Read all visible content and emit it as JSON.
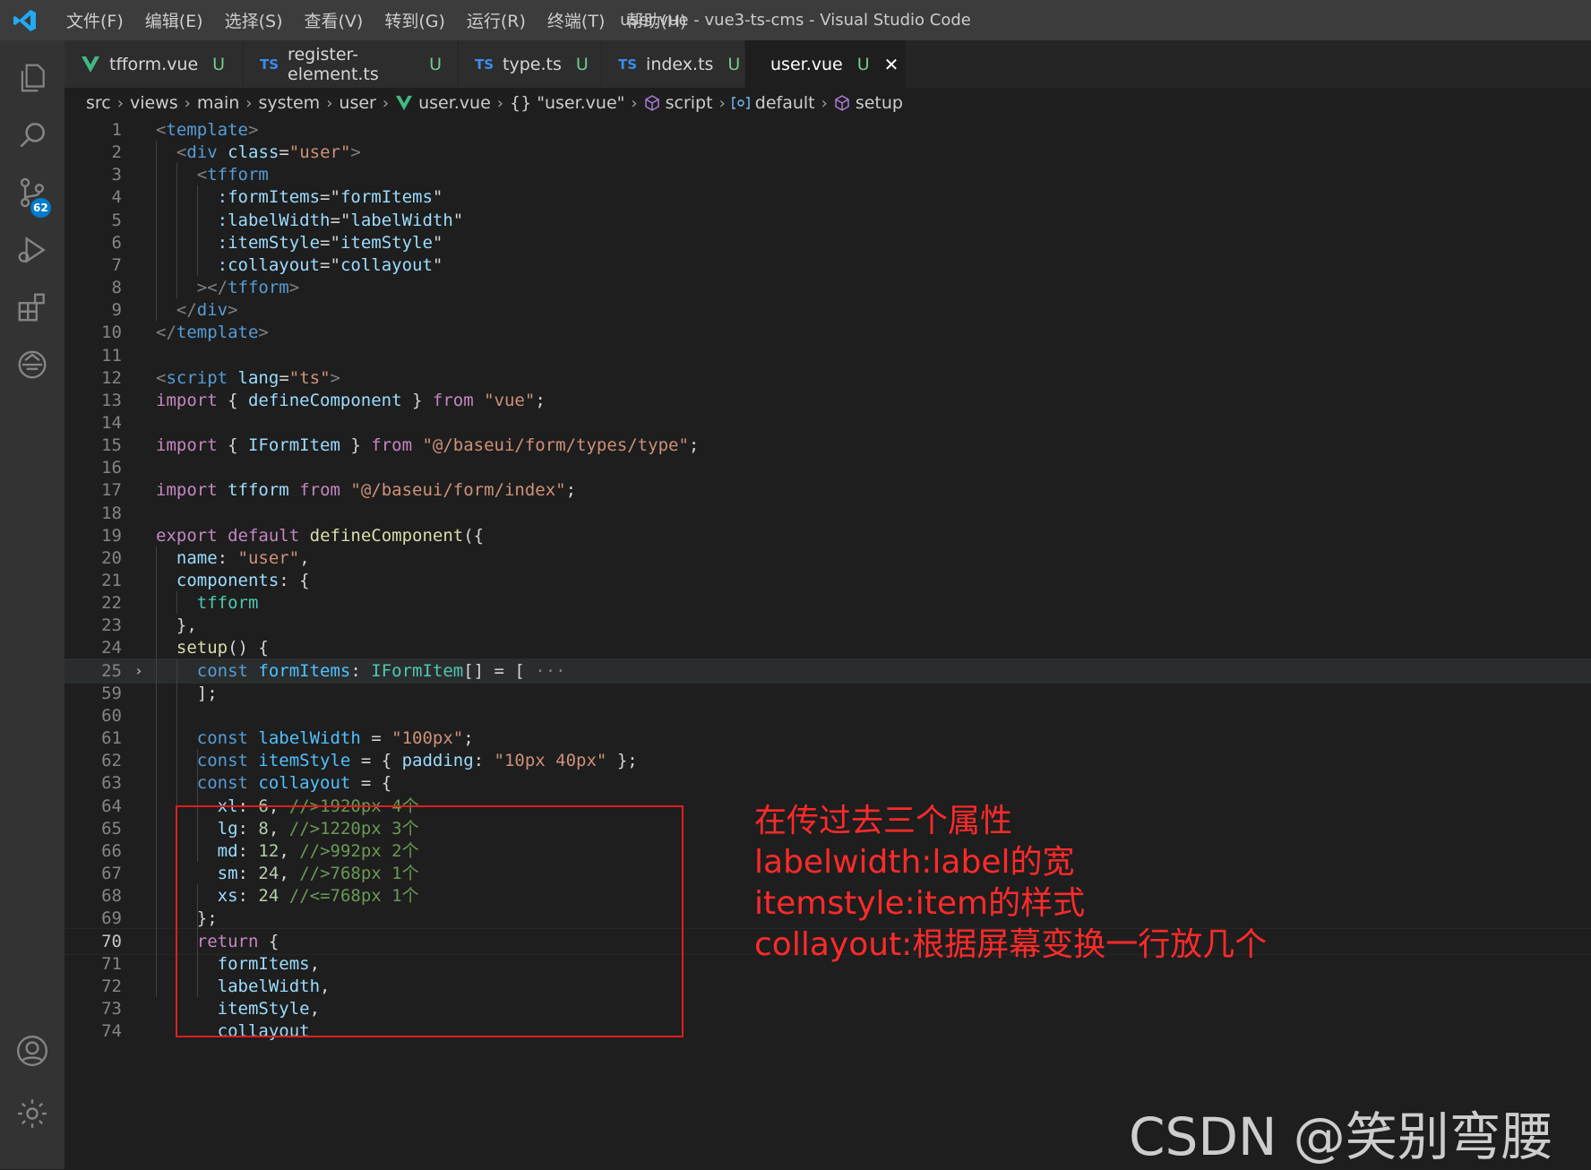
{
  "titlebar": {
    "menu": [
      "文件(F)",
      "编辑(E)",
      "选择(S)",
      "查看(V)",
      "转到(G)",
      "运行(R)",
      "终端(T)",
      "帮助(H)"
    ],
    "title": "user.vue - vue3-ts-cms - Visual Studio Code"
  },
  "activitybar": {
    "items": [
      "explorer-icon",
      "search-icon",
      "source-control-icon",
      "run-debug-icon",
      "extensions-icon",
      "remote-icon"
    ],
    "source_control_badge": "62",
    "bottom": [
      "account-icon",
      "settings-gear-icon"
    ]
  },
  "tabs": [
    {
      "icon": "V",
      "label": "tfform.vue",
      "status": "U"
    },
    {
      "icon": "TS",
      "label": "register-element.ts",
      "status": "U"
    },
    {
      "icon": "TS",
      "label": "type.ts",
      "status": "U"
    },
    {
      "icon": "TS",
      "label": "index.ts",
      "status": "U"
    },
    {
      "icon": "V",
      "label": "user.vue",
      "status": "U",
      "active": true
    }
  ],
  "breadcrumb": [
    "src",
    "views",
    "main",
    "system",
    "user",
    "user.vue",
    "{} \"user.vue\"",
    "script",
    "default",
    "setup"
  ],
  "code": [
    {
      "n": "1",
      "t": [
        [
          "t-pun",
          "<"
        ],
        [
          "t-tag",
          "template"
        ],
        [
          "t-pun",
          ">"
        ]
      ]
    },
    {
      "n": "2",
      "t": [
        [
          "t-plain",
          "  "
        ],
        [
          "t-pun",
          "<"
        ],
        [
          "t-tag",
          "div"
        ],
        [
          "t-plain",
          " "
        ],
        [
          "t-attr",
          "class"
        ],
        [
          "t-plain",
          "="
        ],
        [
          "t-str",
          "\"user\""
        ],
        [
          "t-pun",
          ">"
        ]
      ]
    },
    {
      "n": "3",
      "t": [
        [
          "t-plain",
          "    "
        ],
        [
          "t-pun",
          "<"
        ],
        [
          "t-tag",
          "tfform"
        ]
      ]
    },
    {
      "n": "4",
      "t": [
        [
          "t-plain",
          "      "
        ],
        [
          "t-attr",
          ":formItems"
        ],
        [
          "t-plain",
          "="
        ],
        [
          "t-plain",
          "\""
        ],
        [
          "t-var",
          "formItems"
        ],
        [
          "t-plain",
          "\""
        ]
      ]
    },
    {
      "n": "5",
      "t": [
        [
          "t-plain",
          "      "
        ],
        [
          "t-attr",
          ":labelWidth"
        ],
        [
          "t-plain",
          "="
        ],
        [
          "t-plain",
          "\""
        ],
        [
          "t-var",
          "labelWidth"
        ],
        [
          "t-plain",
          "\""
        ]
      ]
    },
    {
      "n": "6",
      "t": [
        [
          "t-plain",
          "      "
        ],
        [
          "t-attr",
          ":itemStyle"
        ],
        [
          "t-plain",
          "="
        ],
        [
          "t-plain",
          "\""
        ],
        [
          "t-var",
          "itemStyle"
        ],
        [
          "t-plain",
          "\""
        ]
      ]
    },
    {
      "n": "7",
      "t": [
        [
          "t-plain",
          "      "
        ],
        [
          "t-attr",
          ":collayout"
        ],
        [
          "t-plain",
          "="
        ],
        [
          "t-plain",
          "\""
        ],
        [
          "t-var",
          "collayout"
        ],
        [
          "t-plain",
          "\""
        ]
      ]
    },
    {
      "n": "8",
      "t": [
        [
          "t-plain",
          "    "
        ],
        [
          "t-pun",
          "></"
        ],
        [
          "t-tag",
          "tfform"
        ],
        [
          "t-pun",
          ">"
        ]
      ]
    },
    {
      "n": "9",
      "t": [
        [
          "t-plain",
          "  "
        ],
        [
          "t-pun",
          "</"
        ],
        [
          "t-tag",
          "div"
        ],
        [
          "t-pun",
          ">"
        ]
      ]
    },
    {
      "n": "10",
      "t": [
        [
          "t-pun",
          "</"
        ],
        [
          "t-tag",
          "template"
        ],
        [
          "t-pun",
          ">"
        ]
      ]
    },
    {
      "n": "11",
      "t": []
    },
    {
      "n": "12",
      "t": [
        [
          "t-pun",
          "<"
        ],
        [
          "t-tag",
          "script"
        ],
        [
          "t-plain",
          " "
        ],
        [
          "t-attr",
          "lang"
        ],
        [
          "t-plain",
          "="
        ],
        [
          "t-str",
          "\"ts\""
        ],
        [
          "t-pun",
          ">"
        ]
      ]
    },
    {
      "n": "13",
      "t": [
        [
          "t-kw",
          "import"
        ],
        [
          "t-plain",
          " { "
        ],
        [
          "t-var",
          "defineComponent"
        ],
        [
          "t-plain",
          " } "
        ],
        [
          "t-kw",
          "from"
        ],
        [
          "t-plain",
          " "
        ],
        [
          "t-str",
          "\"vue\""
        ],
        [
          "t-plain",
          ";"
        ]
      ]
    },
    {
      "n": "14",
      "t": []
    },
    {
      "n": "15",
      "t": [
        [
          "t-kw",
          "import"
        ],
        [
          "t-plain",
          " { "
        ],
        [
          "t-var",
          "IFormItem"
        ],
        [
          "t-plain",
          " } "
        ],
        [
          "t-kw",
          "from"
        ],
        [
          "t-plain",
          " "
        ],
        [
          "t-str",
          "\"@/baseui/form/types/type\""
        ],
        [
          "t-plain",
          ";"
        ]
      ]
    },
    {
      "n": "16",
      "t": []
    },
    {
      "n": "17",
      "t": [
        [
          "t-kw",
          "import"
        ],
        [
          "t-plain",
          " "
        ],
        [
          "t-var",
          "tfform"
        ],
        [
          "t-plain",
          " "
        ],
        [
          "t-kw",
          "from"
        ],
        [
          "t-plain",
          " "
        ],
        [
          "t-str",
          "\"@/baseui/form/index\""
        ],
        [
          "t-plain",
          ";"
        ]
      ]
    },
    {
      "n": "18",
      "t": []
    },
    {
      "n": "19",
      "t": [
        [
          "t-kw",
          "export"
        ],
        [
          "t-plain",
          " "
        ],
        [
          "t-kw",
          "default"
        ],
        [
          "t-plain",
          " "
        ],
        [
          "t-fn",
          "defineComponent"
        ],
        [
          "t-plain",
          "({"
        ]
      ]
    },
    {
      "n": "20",
      "t": [
        [
          "t-plain",
          "  "
        ],
        [
          "t-var",
          "name"
        ],
        [
          "t-plain",
          ": "
        ],
        [
          "t-str",
          "\"user\""
        ],
        [
          "t-plain",
          ","
        ]
      ]
    },
    {
      "n": "21",
      "t": [
        [
          "t-plain",
          "  "
        ],
        [
          "t-var",
          "components"
        ],
        [
          "t-plain",
          ": {"
        ]
      ]
    },
    {
      "n": "22",
      "t": [
        [
          "t-plain",
          "    "
        ],
        [
          "t-type",
          "tfform"
        ]
      ]
    },
    {
      "n": "23",
      "t": [
        [
          "t-plain",
          "  },"
        ]
      ]
    },
    {
      "n": "24",
      "t": [
        [
          "t-plain",
          "  "
        ],
        [
          "t-fn",
          "setup"
        ],
        [
          "t-plain",
          "() {"
        ]
      ]
    },
    {
      "n": "25",
      "fold": true,
      "t": [
        [
          "t-plain",
          "    "
        ],
        [
          "t-dec",
          "const"
        ],
        [
          "t-plain",
          " "
        ],
        [
          "t-const",
          "formItems"
        ],
        [
          "t-plain",
          ": "
        ],
        [
          "t-type",
          "IFormItem"
        ],
        [
          "t-plain",
          "[] = [ "
        ],
        [
          "t-pun",
          "···"
        ]
      ]
    },
    {
      "n": "59",
      "t": [
        [
          "t-plain",
          "    ];"
        ]
      ]
    },
    {
      "n": "60",
      "t": []
    },
    {
      "n": "61",
      "t": [
        [
          "t-plain",
          "    "
        ],
        [
          "t-dec",
          "const"
        ],
        [
          "t-plain",
          " "
        ],
        [
          "t-const",
          "labelWidth"
        ],
        [
          "t-plain",
          " = "
        ],
        [
          "t-str",
          "\"100px\""
        ],
        [
          "t-plain",
          ";"
        ]
      ]
    },
    {
      "n": "62",
      "t": [
        [
          "t-plain",
          "    "
        ],
        [
          "t-dec",
          "const"
        ],
        [
          "t-plain",
          " "
        ],
        [
          "t-const",
          "itemStyle"
        ],
        [
          "t-plain",
          " = { "
        ],
        [
          "t-var",
          "padding"
        ],
        [
          "t-plain",
          ": "
        ],
        [
          "t-str",
          "\"10px 40px\""
        ],
        [
          "t-plain",
          " };"
        ]
      ]
    },
    {
      "n": "63",
      "t": [
        [
          "t-plain",
          "    "
        ],
        [
          "t-dec",
          "const"
        ],
        [
          "t-plain",
          " "
        ],
        [
          "t-const",
          "collayout"
        ],
        [
          "t-plain",
          " = {"
        ]
      ]
    },
    {
      "n": "64",
      "t": [
        [
          "t-plain",
          "      "
        ],
        [
          "t-var",
          "xl"
        ],
        [
          "t-plain",
          ": "
        ],
        [
          "t-num",
          "6"
        ],
        [
          "t-plain",
          ", "
        ],
        [
          "t-cmt",
          "//>1920px 4个"
        ]
      ]
    },
    {
      "n": "65",
      "t": [
        [
          "t-plain",
          "      "
        ],
        [
          "t-var",
          "lg"
        ],
        [
          "t-plain",
          ": "
        ],
        [
          "t-num",
          "8"
        ],
        [
          "t-plain",
          ", "
        ],
        [
          "t-cmt",
          "//>1220px 3个"
        ]
      ]
    },
    {
      "n": "66",
      "t": [
        [
          "t-plain",
          "      "
        ],
        [
          "t-var",
          "md"
        ],
        [
          "t-plain",
          ": "
        ],
        [
          "t-num",
          "12"
        ],
        [
          "t-plain",
          ", "
        ],
        [
          "t-cmt",
          "//>992px 2个"
        ]
      ]
    },
    {
      "n": "67",
      "t": [
        [
          "t-plain",
          "      "
        ],
        [
          "t-var",
          "sm"
        ],
        [
          "t-plain",
          ": "
        ],
        [
          "t-num",
          "24"
        ],
        [
          "t-plain",
          ", "
        ],
        [
          "t-cmt",
          "//>768px 1个"
        ]
      ]
    },
    {
      "n": "68",
      "t": [
        [
          "t-plain",
          "      "
        ],
        [
          "t-var",
          "xs"
        ],
        [
          "t-plain",
          ": "
        ],
        [
          "t-num",
          "24"
        ],
        [
          "t-plain",
          " "
        ],
        [
          "t-cmt",
          "//<=768px 1个"
        ]
      ]
    },
    {
      "n": "69",
      "t": [
        [
          "t-plain",
          "    };"
        ]
      ]
    },
    {
      "n": "70",
      "current": true,
      "t": [
        [
          "t-plain",
          "    "
        ],
        [
          "t-kw",
          "return"
        ],
        [
          "t-plain",
          " {"
        ]
      ]
    },
    {
      "n": "71",
      "t": [
        [
          "t-plain",
          "      "
        ],
        [
          "t-var",
          "formItems"
        ],
        [
          "t-plain",
          ","
        ]
      ]
    },
    {
      "n": "72",
      "t": [
        [
          "t-plain",
          "      "
        ],
        [
          "t-var",
          "labelWidth"
        ],
        [
          "t-plain",
          ","
        ]
      ]
    },
    {
      "n": "73",
      "t": [
        [
          "t-plain",
          "      "
        ],
        [
          "t-var",
          "itemStyle"
        ],
        [
          "t-plain",
          ","
        ]
      ]
    },
    {
      "n": "74",
      "t": [
        [
          "t-plain",
          "      "
        ],
        [
          "t-var",
          "collayout"
        ]
      ]
    }
  ],
  "annotation": {
    "lines": [
      "在传过去三个属性",
      "labelwidth:label的宽",
      "itemstyle:item的样式",
      "collayout:根据屏幕变换一行放几个"
    ],
    "color": "#ff2a2a"
  },
  "watermark": "CSDN @笑别弯腰"
}
